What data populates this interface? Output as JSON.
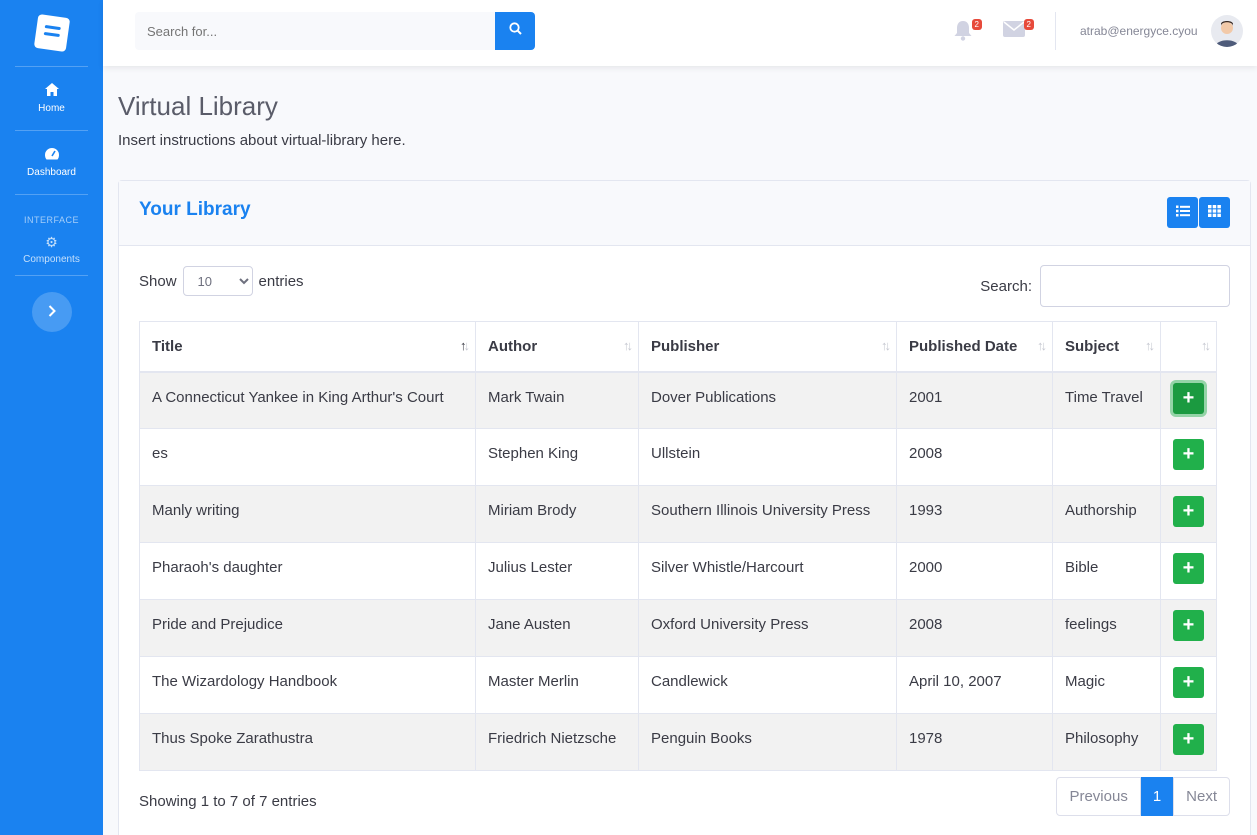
{
  "sidebar": {
    "items": [
      {
        "label": "Home",
        "icon": "home-icon"
      },
      {
        "label": "Dashboard",
        "icon": "tachometer-icon"
      }
    ],
    "heading": "INTERFACE",
    "components": {
      "label": "Components",
      "icon": "gear-icon"
    }
  },
  "topbar": {
    "search_placeholder": "Search for...",
    "alerts_count": "2",
    "messages_count": "2",
    "user_email": "atrab@energyce.cyou"
  },
  "page": {
    "title": "Virtual Library",
    "description": "Insert instructions about virtual-library here."
  },
  "card": {
    "title": "Your Library"
  },
  "datatable": {
    "show_label": "Show",
    "entries_label": "entries",
    "page_length": "10",
    "search_label": "Search:",
    "columns": [
      "Title",
      "Author",
      "Publisher",
      "Published Date",
      "Subject",
      ""
    ],
    "rows": [
      [
        "A Connecticut Yankee in King Arthur's Court",
        "Mark Twain",
        "Dover Publications",
        "2001",
        "Time Travel"
      ],
      [
        "es",
        "Stephen King",
        "Ullstein",
        "2008",
        ""
      ],
      [
        "Manly writing",
        "Miriam Brody",
        "Southern Illinois University Press",
        "1993",
        "Authorship"
      ],
      [
        "Pharaoh's daughter",
        "Julius Lester",
        "Silver Whistle/Harcourt",
        "2000",
        "Bible"
      ],
      [
        "Pride and Prejudice",
        "Jane Austen",
        "Oxford University Press",
        "2008",
        "feelings"
      ],
      [
        "The Wizardology Handbook",
        "Master Merlin",
        "Candlewick",
        "April 10, 2007",
        "Magic"
      ],
      [
        "Thus Spoke Zarathustra",
        "Friedrich Nietzsche",
        "Penguin Books",
        "1978",
        "Philosophy"
      ]
    ],
    "info": "Showing 1 to 7 of 7 entries",
    "pagination": {
      "previous": "Previous",
      "current": "1",
      "next": "Next"
    }
  },
  "colors": {
    "primary": "#1a82f0",
    "success": "#21b04b",
    "badge": "#e74a3b"
  }
}
